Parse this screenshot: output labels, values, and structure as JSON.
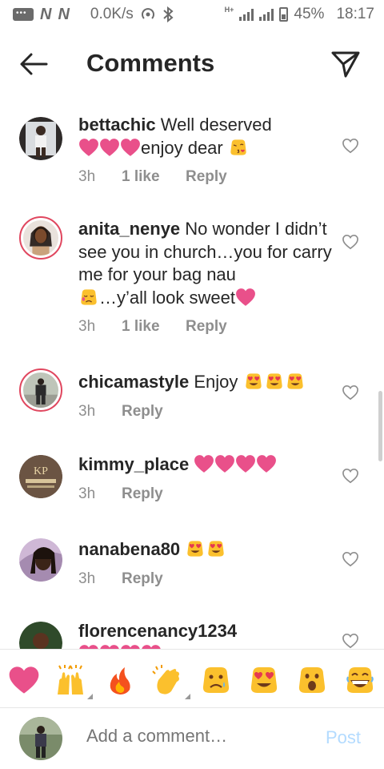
{
  "status_bar": {
    "net_speed": "0.0K/s",
    "network_label": "H+",
    "battery": "45%",
    "time": "18:17"
  },
  "header": {
    "title": "Comments"
  },
  "comments": [
    {
      "username": "bettachic",
      "text_a": "Well deserved",
      "text_b": "enjoy dear",
      "time": "3h",
      "likes": "1 like",
      "reply": "Reply"
    },
    {
      "username": "anita_nenye",
      "text_a": "No wonder I didn’t see you in church…you for carry me for your bag nau",
      "text_b": "…y’all look sweet",
      "time": "3h",
      "likes": "1 like",
      "reply": "Reply"
    },
    {
      "username": "chicamastyle",
      "text_a": "Enjoy",
      "time": "3h",
      "reply": "Reply"
    },
    {
      "username": "kimmy_place",
      "time": "3h",
      "reply": "Reply"
    },
    {
      "username": "nanabena80",
      "time": "3h",
      "reply": "Reply"
    },
    {
      "username": "florencenancy1234"
    }
  ],
  "emoji_bar": [
    "heart-emoji",
    "raised-hands-emoji",
    "fire-emoji",
    "clapping-hands-emoji",
    "sad-face-emoji",
    "heart-eyes-emoji",
    "surprised-face-emoji",
    "grinning-face-emoji"
  ],
  "composer": {
    "placeholder": "Add a comment…",
    "post_label": "Post"
  },
  "colors": {
    "heart_pink": "#e9508a",
    "emoji_yellow": "#fbc02d",
    "ring": "#e0475f",
    "post_blue": "#b3dbff",
    "muted": "#8e8e8e"
  }
}
